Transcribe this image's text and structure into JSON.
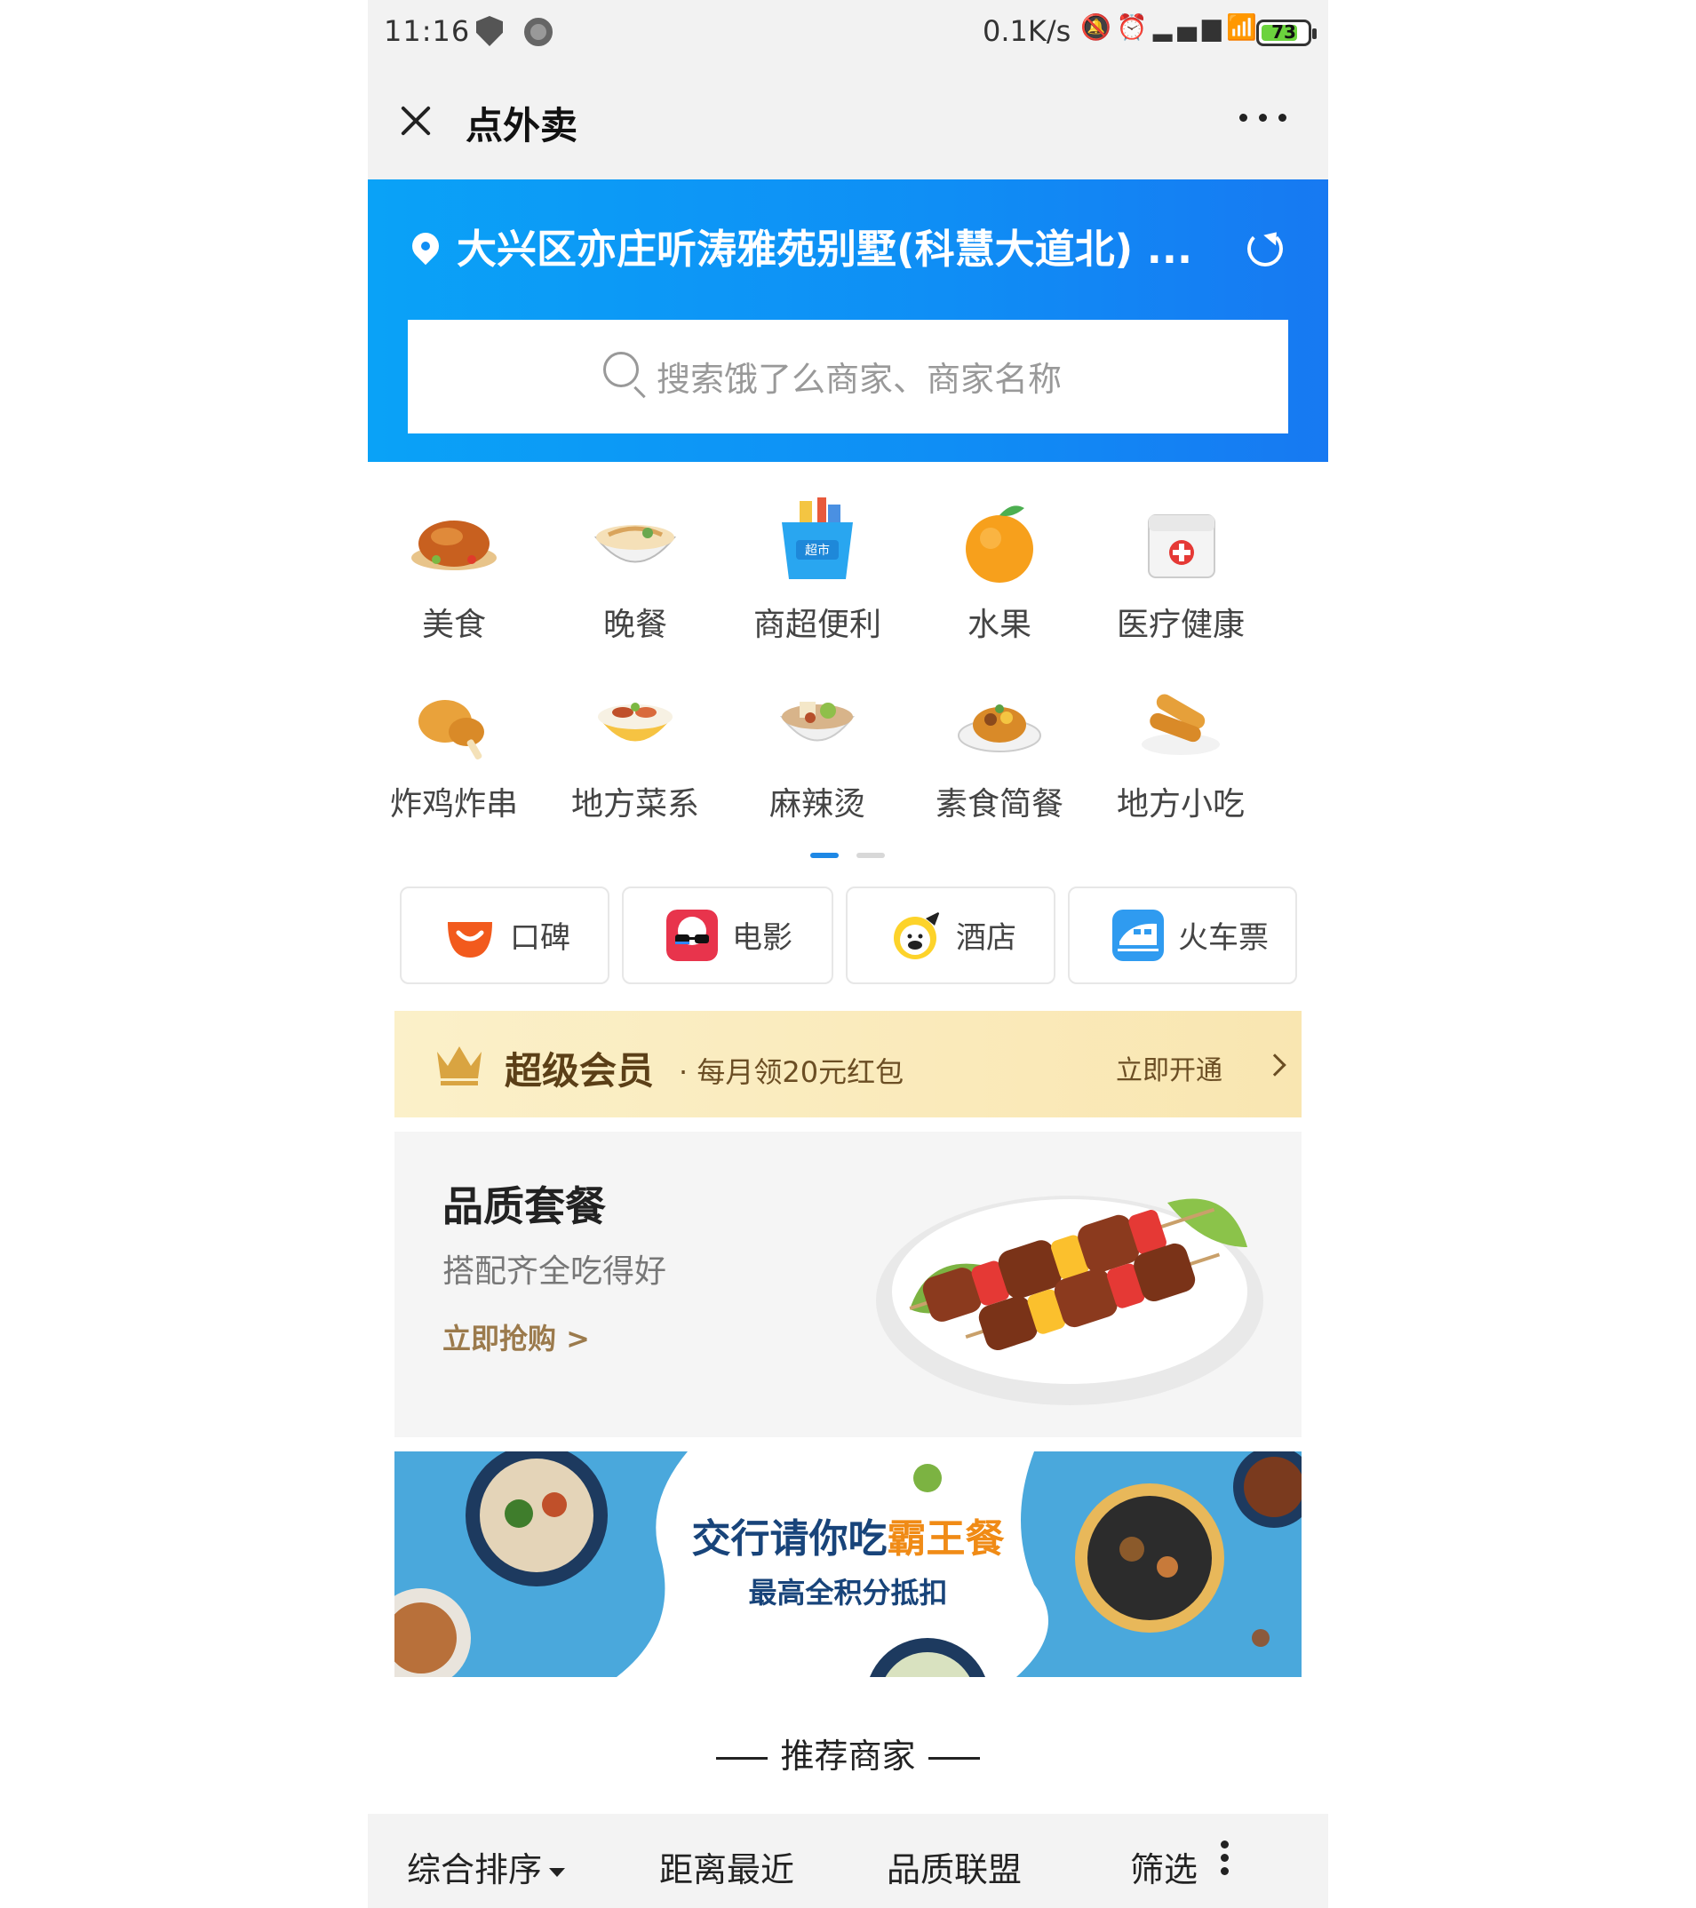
{
  "status_bar": {
    "time": "11:16",
    "net_speed": "0.1K/s",
    "battery": "73",
    "icons": [
      "shield-icon",
      "record-icon",
      "mute-icon",
      "alarm-icon",
      "signal-icon",
      "wifi-icon",
      "battery-icon"
    ]
  },
  "nav": {
    "title": "点外卖"
  },
  "header": {
    "location": "大兴区亦庄听涛雅苑别墅(科慧大道北) ...",
    "search_placeholder": "搜索饿了么商家、商家名称"
  },
  "categories": [
    {
      "label": "美食",
      "icon": "roast-chicken-icon"
    },
    {
      "label": "晚餐",
      "icon": "noodle-bowl-icon"
    },
    {
      "label": "商超便利",
      "icon": "supermarket-basket-icon"
    },
    {
      "label": "水果",
      "icon": "orange-icon"
    },
    {
      "label": "医疗健康",
      "icon": "medical-kit-icon"
    },
    {
      "label": "炸鸡炸串",
      "icon": "fried-chicken-icon"
    },
    {
      "label": "地方菜系",
      "icon": "rice-bowl-icon"
    },
    {
      "label": "麻辣烫",
      "icon": "hotpot-bowl-icon"
    },
    {
      "label": "素食简餐",
      "icon": "plate-meal-icon"
    },
    {
      "label": "地方小吃",
      "icon": "spring-roll-icon"
    }
  ],
  "category_pages": {
    "total": 2,
    "current": 1
  },
  "services": [
    {
      "label": "口碑",
      "icon": "koubei-icon"
    },
    {
      "label": "电影",
      "icon": "movie-icon"
    },
    {
      "label": "酒店",
      "icon": "hotel-pig-icon"
    },
    {
      "label": "火车票",
      "icon": "train-icon"
    }
  ],
  "vip": {
    "title": "超级会员",
    "subtitle": "· 每月领20元红包",
    "cta": "立即开通"
  },
  "quality": {
    "title": "品质套餐",
    "subtitle": "搭配齐全吃得好",
    "cta": "立即抢购 >"
  },
  "bank_banner": {
    "title_prefix": "交行请你吃",
    "title_highlight": "霸王餐",
    "subtitle": "最高全积分抵扣"
  },
  "recommend": {
    "title": "推荐商家"
  },
  "sort": {
    "items": [
      "综合排序",
      "距离最近",
      "品质联盟",
      "筛选"
    ]
  },
  "colors": {
    "brand_blue": "#0f8ef5",
    "vip_brown": "#5b3f17",
    "bank_navy": "#18447a",
    "bank_orange": "#f08b16"
  }
}
